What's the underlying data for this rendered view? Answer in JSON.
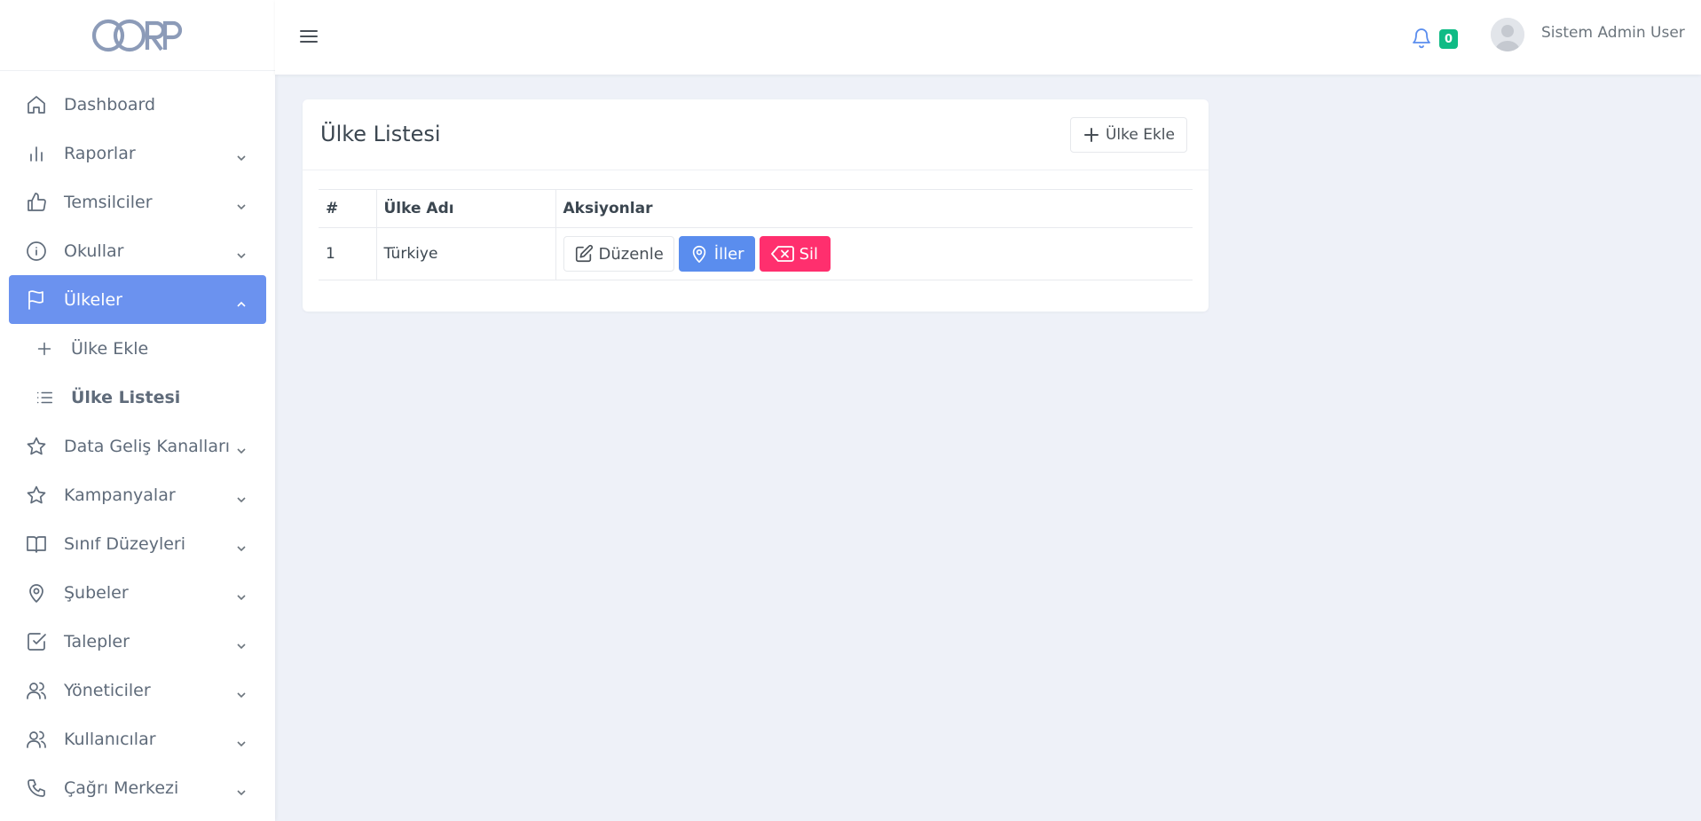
{
  "brand": {
    "logo_text": "CORP"
  },
  "sidebar": {
    "items": [
      {
        "label": "Dashboard",
        "icon": "home-icon",
        "has_children": false
      },
      {
        "label": "Raporlar",
        "icon": "bar-chart-icon",
        "has_children": true
      },
      {
        "label": "Temsilciler",
        "icon": "thumbs-up-icon",
        "has_children": true
      },
      {
        "label": "Okullar",
        "icon": "info-icon",
        "has_children": true
      },
      {
        "label": "Ülkeler",
        "icon": "flag-icon",
        "has_children": true,
        "active": true,
        "children": [
          {
            "label": "Ülke Ekle",
            "icon": "plus-icon"
          },
          {
            "label": "Ülke Listesi",
            "icon": "list-icon",
            "current": true
          }
        ]
      },
      {
        "label": "Data Geliş Kanalları",
        "icon": "star-icon",
        "has_children": true
      },
      {
        "label": "Kampanyalar",
        "icon": "star-icon",
        "has_children": true
      },
      {
        "label": "Sınıf Düzeyleri",
        "icon": "book-icon",
        "has_children": true
      },
      {
        "label": "Şubeler",
        "icon": "map-pin-icon",
        "has_children": true
      },
      {
        "label": "Talepler",
        "icon": "check-square-icon",
        "has_children": true
      },
      {
        "label": "Yöneticiler",
        "icon": "users-icon",
        "has_children": true
      },
      {
        "label": "Kullanıcılar",
        "icon": "users-icon",
        "has_children": true
      },
      {
        "label": "Çağrı Merkezi",
        "icon": "phone-icon",
        "has_children": true
      }
    ]
  },
  "topbar": {
    "notifications_count": "0",
    "user_name": "Sistem Admin User"
  },
  "card": {
    "title": "Ülke Listesi",
    "add_button_label": "Ülke Ekle",
    "table": {
      "headers": [
        "#",
        "Ülke Adı",
        "Aksiyonlar"
      ],
      "rows": [
        {
          "num": "1",
          "name": "Türkiye"
        }
      ],
      "actions": {
        "edit_label": "Düzenle",
        "cities_label": "İller",
        "delete_label": "Sil"
      }
    }
  },
  "colors": {
    "accent": "#5a8dee",
    "active_menu": "#6b92ef",
    "danger": "#ff2f6e",
    "success_badge": "#0fbb85",
    "background": "#eef1f8"
  }
}
